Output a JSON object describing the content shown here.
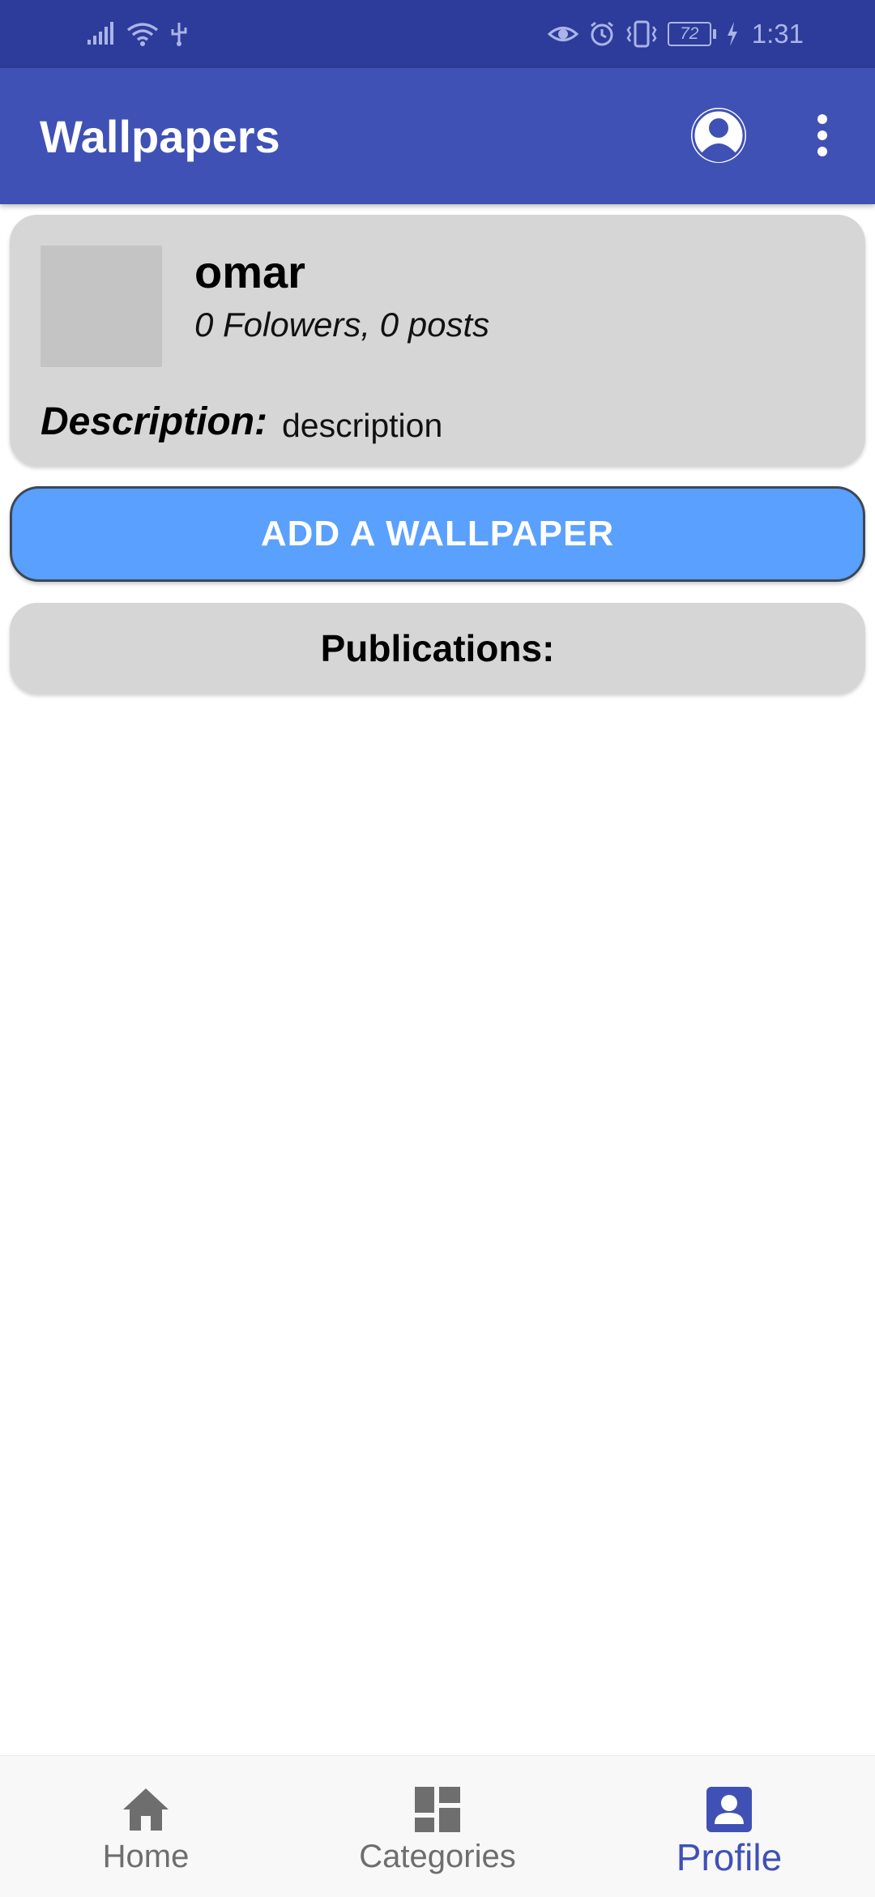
{
  "status_bar": {
    "time": "1:31",
    "battery": "72",
    "icons": [
      "signal-icon",
      "wifi-icon",
      "usb-icon",
      "eye-icon",
      "alarm-icon",
      "vibrate-icon",
      "battery-icon",
      "charging-icon"
    ]
  },
  "app_bar": {
    "title": "Wallpapers",
    "icons": [
      "account-icon",
      "more-vert-icon"
    ]
  },
  "profile": {
    "name": "omar",
    "stats": "0 Folowers, 0 posts",
    "description_label": "Description:",
    "description": "description"
  },
  "actions": {
    "add_wallpaper": "ADD A WALLPAPER"
  },
  "publications": {
    "header": "Publications:"
  },
  "bottom_nav": {
    "items": [
      {
        "label": "Home",
        "icon": "home-icon"
      },
      {
        "label": "Categories",
        "icon": "dashboard-icon"
      },
      {
        "label": "Profile",
        "icon": "profile-icon"
      }
    ],
    "active": "Profile"
  },
  "colors": {
    "primary": "#3f51b5",
    "primary_dark": "#2d3c9a",
    "accent_button": "#59a0ff",
    "card": "#d6d6d6"
  }
}
